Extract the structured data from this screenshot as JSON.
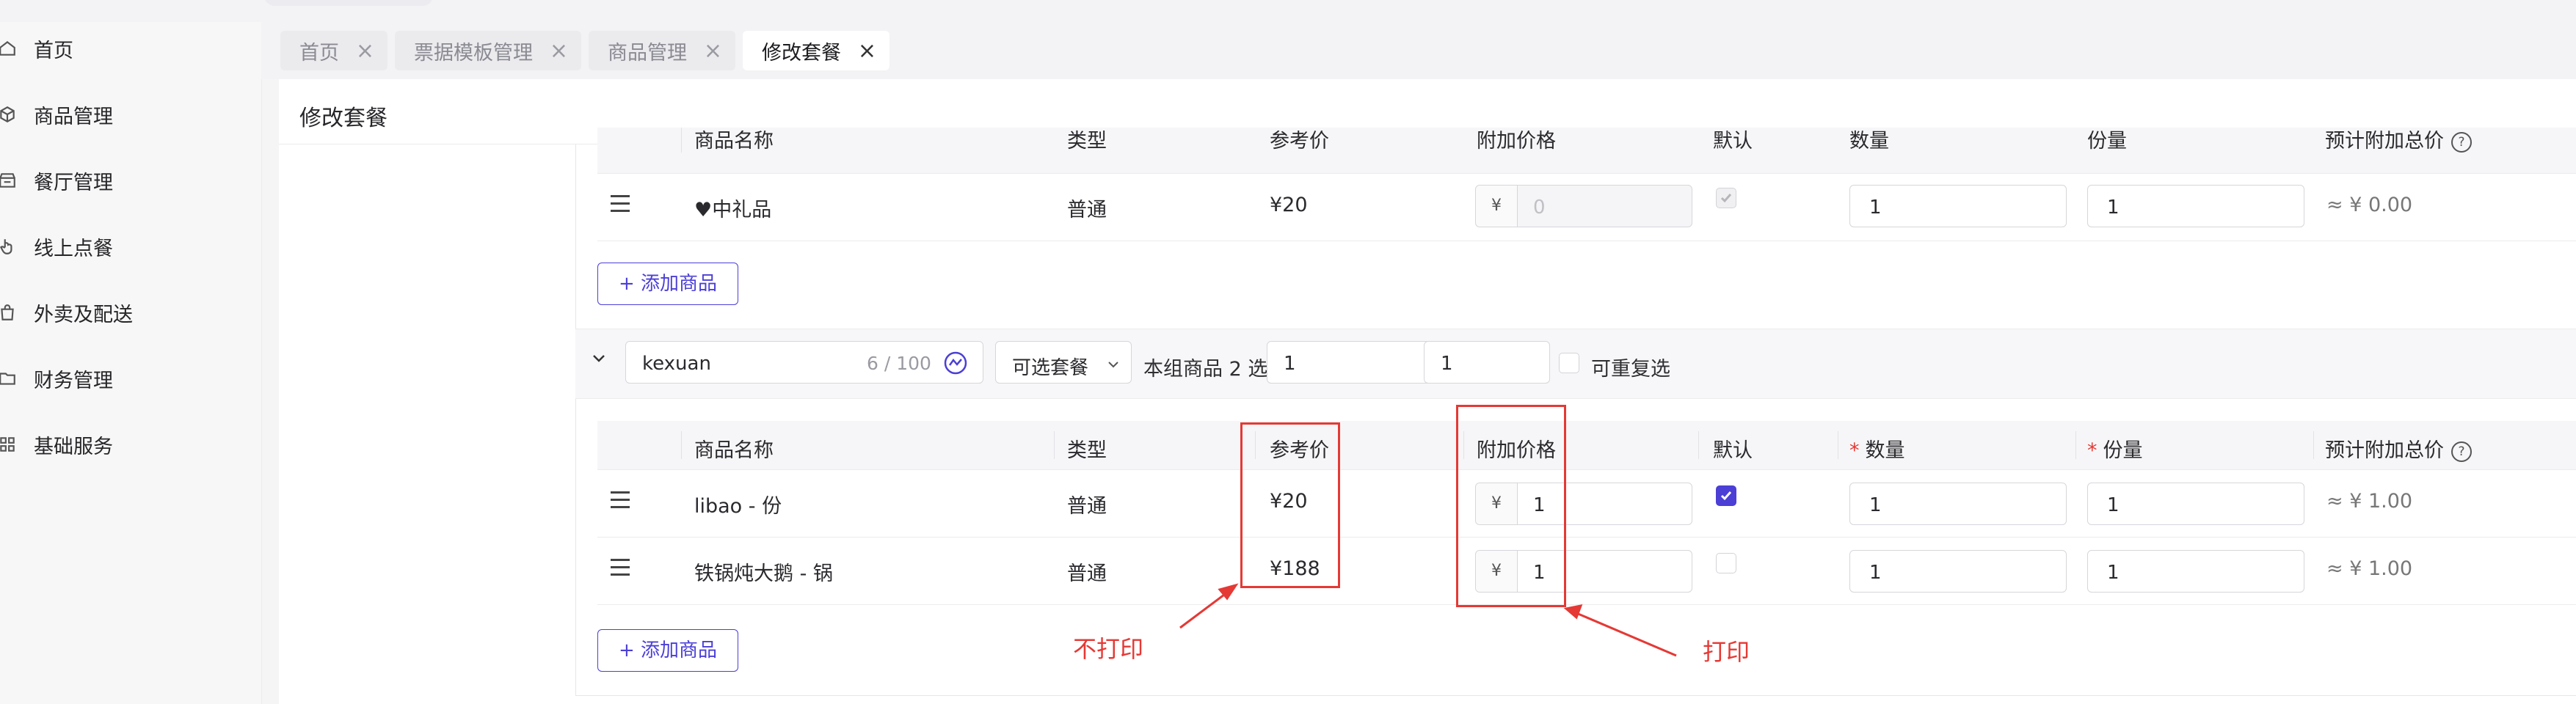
{
  "sidebar": {
    "items": [
      {
        "label": "首页",
        "icon": "home-icon"
      },
      {
        "label": "商品管理",
        "icon": "cube-icon"
      },
      {
        "label": "餐厅管理",
        "icon": "store-icon"
      },
      {
        "label": "线上点餐",
        "icon": "pointer-icon"
      },
      {
        "label": "外卖及配送",
        "icon": "bag-icon"
      },
      {
        "label": "财务管理",
        "icon": "folder-icon"
      },
      {
        "label": "基础服务",
        "icon": "grid-icon"
      }
    ]
  },
  "tabs": [
    {
      "label": "首页",
      "active": false
    },
    {
      "label": "票据模板管理",
      "active": false
    },
    {
      "label": "商品管理",
      "active": false
    },
    {
      "label": "修改套餐",
      "active": true
    }
  ],
  "page_title": "修改套餐",
  "table_headers": {
    "name": "商品名称",
    "type": "类型",
    "ref_price": "参考价",
    "extra_price": "附加价格",
    "default": "默认",
    "qty": "数量",
    "portion": "份量",
    "est_total": "预计附加总价",
    "required_mark": "*",
    "help_mark": "?"
  },
  "group1": {
    "rows": [
      {
        "name": "♥中礼品",
        "type": "普通",
        "ref_price": "¥20",
        "currency": "¥",
        "extra_price": "0",
        "default": true,
        "default_disabled": true,
        "qty": "1",
        "portion": "1",
        "est_total": "≈ ¥ 0.00"
      }
    ],
    "add_button": "+ 添加商品"
  },
  "group2": {
    "name_value": "kexuan",
    "name_count": "6 / 100",
    "type_select": "可选套餐",
    "rule_label": "本组商品 2 选",
    "min_value": "1",
    "range_sep": "~",
    "max_value": "1",
    "repeat_label": "可重复选",
    "rows": [
      {
        "name": "libao - 份",
        "type": "普通",
        "ref_price": "¥20",
        "currency": "¥",
        "extra_price": "1",
        "default": true,
        "qty": "1",
        "portion": "1",
        "est_total": "≈ ¥ 1.00"
      },
      {
        "name": "铁锅炖大鹅 - 锅",
        "type": "普通",
        "ref_price": "¥188",
        "currency": "¥",
        "extra_price": "1",
        "default": false,
        "qty": "1",
        "portion": "1",
        "est_total": "≈ ¥ 1.00"
      }
    ],
    "add_button": "+ 添加商品"
  },
  "annotations": {
    "no_print": "不打印",
    "print": "打印"
  },
  "colors": {
    "accent": "#4b3fd6",
    "annotation": "#e53935"
  }
}
